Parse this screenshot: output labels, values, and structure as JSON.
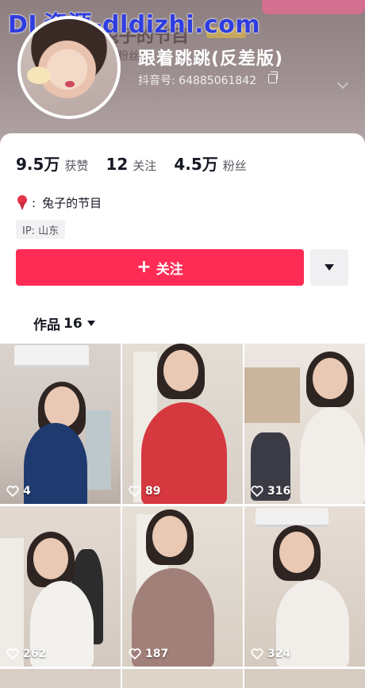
{
  "watermark": "DL资源-dldizhi.com",
  "header": {
    "bg_name": "兔子的节目",
    "bg_sub": "粉丝",
    "bg_num": "2",
    "display_name": "跟着跳跳(反差版)",
    "douyin_id": "抖音号: 64885061842"
  },
  "stats": [
    {
      "num": "9.5万",
      "label": "获赞"
    },
    {
      "num": "12",
      "label": "关注"
    },
    {
      "num": "4.5万",
      "label": "粉丝"
    }
  ],
  "collection": {
    "colon": ":",
    "name": "兔子的节目"
  },
  "ip": "IP: 山东",
  "follow_label": "关注",
  "follow_plus": "+",
  "works": {
    "label": "作品",
    "count": "16"
  },
  "videos": [
    {
      "likes": "4"
    },
    {
      "likes": "89"
    },
    {
      "likes": "316"
    },
    {
      "likes": "262"
    },
    {
      "likes": "187"
    },
    {
      "likes": "324"
    }
  ],
  "colors": {
    "follow": "#fe2c55",
    "text": "#161823",
    "watermark": "#2f3de0"
  },
  "icons": [
    "copy-icon",
    "expand-icon",
    "ribbon-icon",
    "plus-icon",
    "triangle-down-icon",
    "heart-icon"
  ]
}
